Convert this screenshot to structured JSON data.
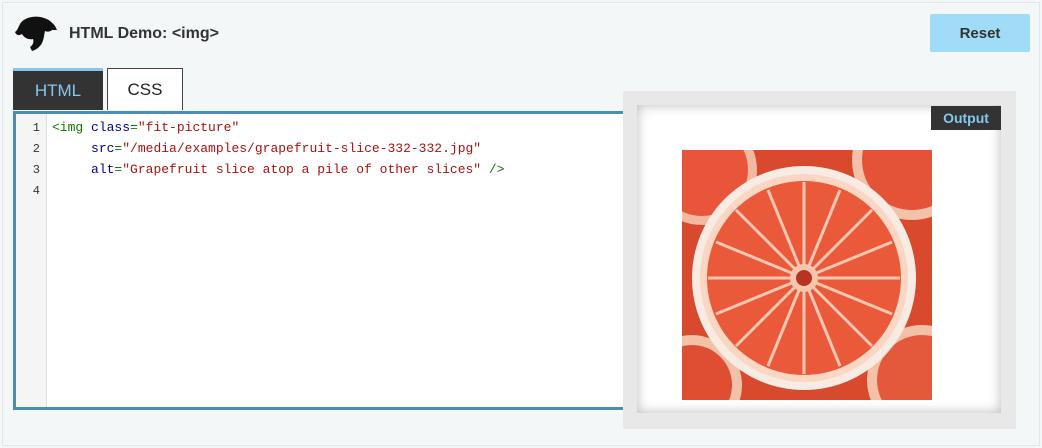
{
  "header": {
    "title": "HTML Demo: <img>",
    "reset_label": "Reset"
  },
  "tabs": [
    {
      "label": "HTML",
      "active": true
    },
    {
      "label": "CSS",
      "active": false
    }
  ],
  "editor": {
    "line_numbers": [
      "1",
      "2",
      "3",
      "4"
    ],
    "lines": [
      [
        {
          "t": "tag",
          "v": "<img "
        },
        {
          "t": "attr",
          "v": "class"
        },
        {
          "t": "tag",
          "v": "="
        },
        {
          "t": "str",
          "v": "\"fit-picture\""
        }
      ],
      [
        {
          "t": "tag",
          "v": "     "
        },
        {
          "t": "attr",
          "v": "src"
        },
        {
          "t": "tag",
          "v": "="
        },
        {
          "t": "str",
          "v": "\"/media/examples/grapefruit-slice-332-332.jpg\""
        }
      ],
      [
        {
          "t": "tag",
          "v": "     "
        },
        {
          "t": "attr",
          "v": "alt"
        },
        {
          "t": "tag",
          "v": "="
        },
        {
          "t": "str",
          "v": "\"Grapefruit slice atop a pile of other slices\""
        },
        {
          "t": "tag",
          "v": " />"
        }
      ],
      []
    ]
  },
  "output": {
    "label": "Output",
    "image_alt": "Grapefruit slice atop a pile of other slices"
  },
  "colors": {
    "accent": "#84c7ef",
    "reset_bg": "#a0dcf7",
    "editor_border": "#4d8db3",
    "grapefruit": "#e2553a"
  }
}
